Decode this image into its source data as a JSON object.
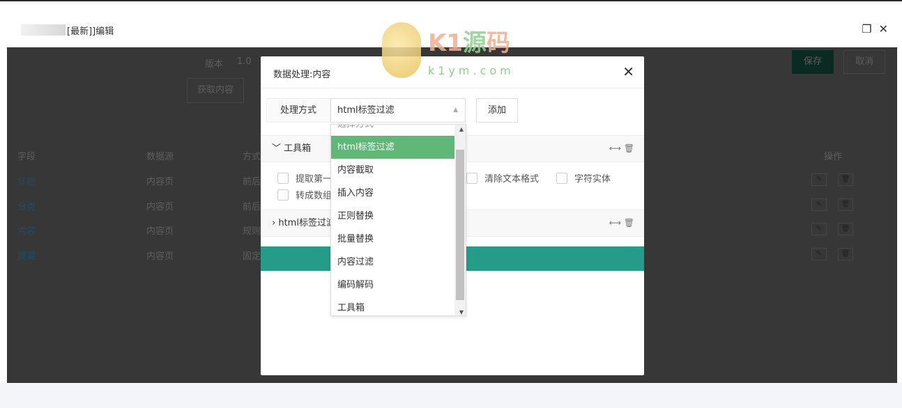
{
  "window": {
    "title": "[最新]]编辑"
  },
  "background": {
    "version_label": "版本",
    "version_value": "1.0",
    "fetch_button": "获取内容",
    "save_button": "保存",
    "cancel_button": "取消",
    "table": {
      "headers": [
        "字段",
        "数据源",
        "方式",
        "操作"
      ],
      "rows": [
        {
          "field": "标题",
          "source": "内容页",
          "method": "前后"
        },
        {
          "field": "分类",
          "source": "内容页",
          "method": "前后"
        },
        {
          "field": "内容",
          "source": "内容页",
          "method": "规则"
        },
        {
          "field": "摘要",
          "source": "内容页",
          "method": "固定"
        }
      ]
    }
  },
  "modal": {
    "title": "数据处理:内容",
    "method_label": "处理方式",
    "method_value": "html标签过滤",
    "add_button": "添加",
    "sections": [
      {
        "title": "工具箱",
        "expanded": true,
        "options": [
          "提取第一",
          "清除文本格式",
          "字符实体",
          "转成数组"
        ]
      },
      {
        "title": "html标签过滤",
        "expanded": false
      }
    ],
    "dropdown": {
      "options": [
        "选择方式",
        "html标签过滤",
        "内容截取",
        "插入内容",
        "正则替换",
        "批量替换",
        "内容过滤",
        "编码解码",
        "工具箱"
      ],
      "selected": "html标签过滤"
    }
  },
  "watermark": {
    "brand": "K1源码",
    "url": "k1ym.com"
  },
  "colors": {
    "selected": "#5fb878",
    "accent": "#259b8a",
    "overlay": "#373737"
  }
}
